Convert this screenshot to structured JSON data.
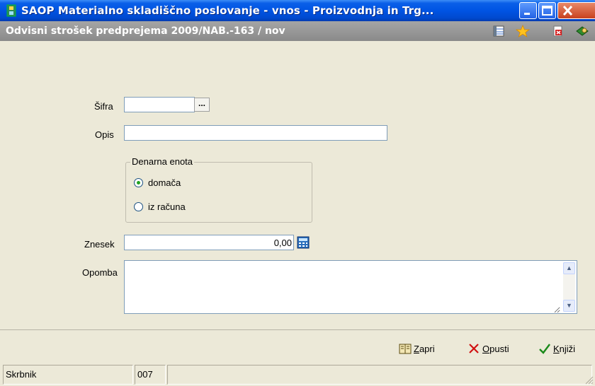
{
  "window": {
    "title": "SAOP Materialno skladiščno poslovanje - vnos - Proizvodnja in Trg...",
    "subtitle": "Odvisni strošek predprejema 2009/NAB.-163 / nov"
  },
  "toolbar_icons": [
    "grid-icon",
    "star-icon",
    "close-doc-icon",
    "exit-icon"
  ],
  "form": {
    "sifra_label": "Šifra",
    "sifra_value": "",
    "sifra_browse_label": "...",
    "opis_label": "Opis",
    "opis_value": "",
    "currency_group_label": "Denarna enota",
    "currency_options": [
      {
        "label": "domača",
        "selected": true
      },
      {
        "label": "iz računa",
        "selected": false
      }
    ],
    "znesek_label": "Znesek",
    "znesek_value": "0,00",
    "opomba_label": "Opomba",
    "opomba_value": ""
  },
  "actions": {
    "zapri": {
      "accel": "Z",
      "rest": "apri"
    },
    "opusti": {
      "accel": "O",
      "rest": "pusti"
    },
    "knjizi": {
      "accel": "K",
      "rest": "njiži"
    }
  },
  "status": {
    "user": "Skrbnik",
    "code": "007",
    "extra": ""
  },
  "colors": {
    "titlebar": "#0054e3",
    "subbar": "#9a9a9a",
    "dialog_bg": "#ece9d8",
    "cancel_red": "#d01010",
    "confirm_green": "#1a8a1a"
  }
}
